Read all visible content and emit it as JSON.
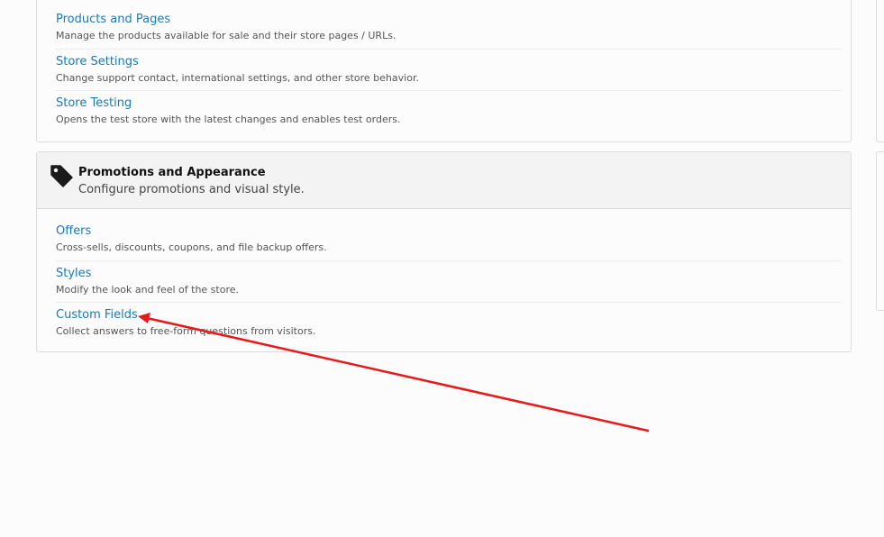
{
  "store_section": {
    "items": [
      {
        "title": "Products and Pages",
        "description": "Manage the products available for sale and their store pages / URLs."
      },
      {
        "title": "Store Settings",
        "description": "Change support contact, international settings, and other store behavior."
      },
      {
        "title": "Store Testing",
        "description": "Opens the test store with the latest changes and enables test orders."
      }
    ]
  },
  "promotions_section": {
    "icon": "tag-icon",
    "title": "Promotions and Appearance",
    "subtitle": "Configure promotions and visual style.",
    "items": [
      {
        "title": "Offers",
        "description": "Cross-sells, discounts, coupons, and file backup offers."
      },
      {
        "title": "Styles",
        "description": "Modify the look and feel of the store."
      },
      {
        "title": "Custom Fields",
        "description": "Collect answers to free-form questions from visitors."
      }
    ]
  },
  "annotation": {
    "type": "arrow",
    "color": "#e8181b",
    "points_to": "Custom Fields"
  },
  "colors": {
    "link": "#1a7ab8",
    "header_bg": "#f3f3f3",
    "page_bg": "#fcfcfc"
  }
}
